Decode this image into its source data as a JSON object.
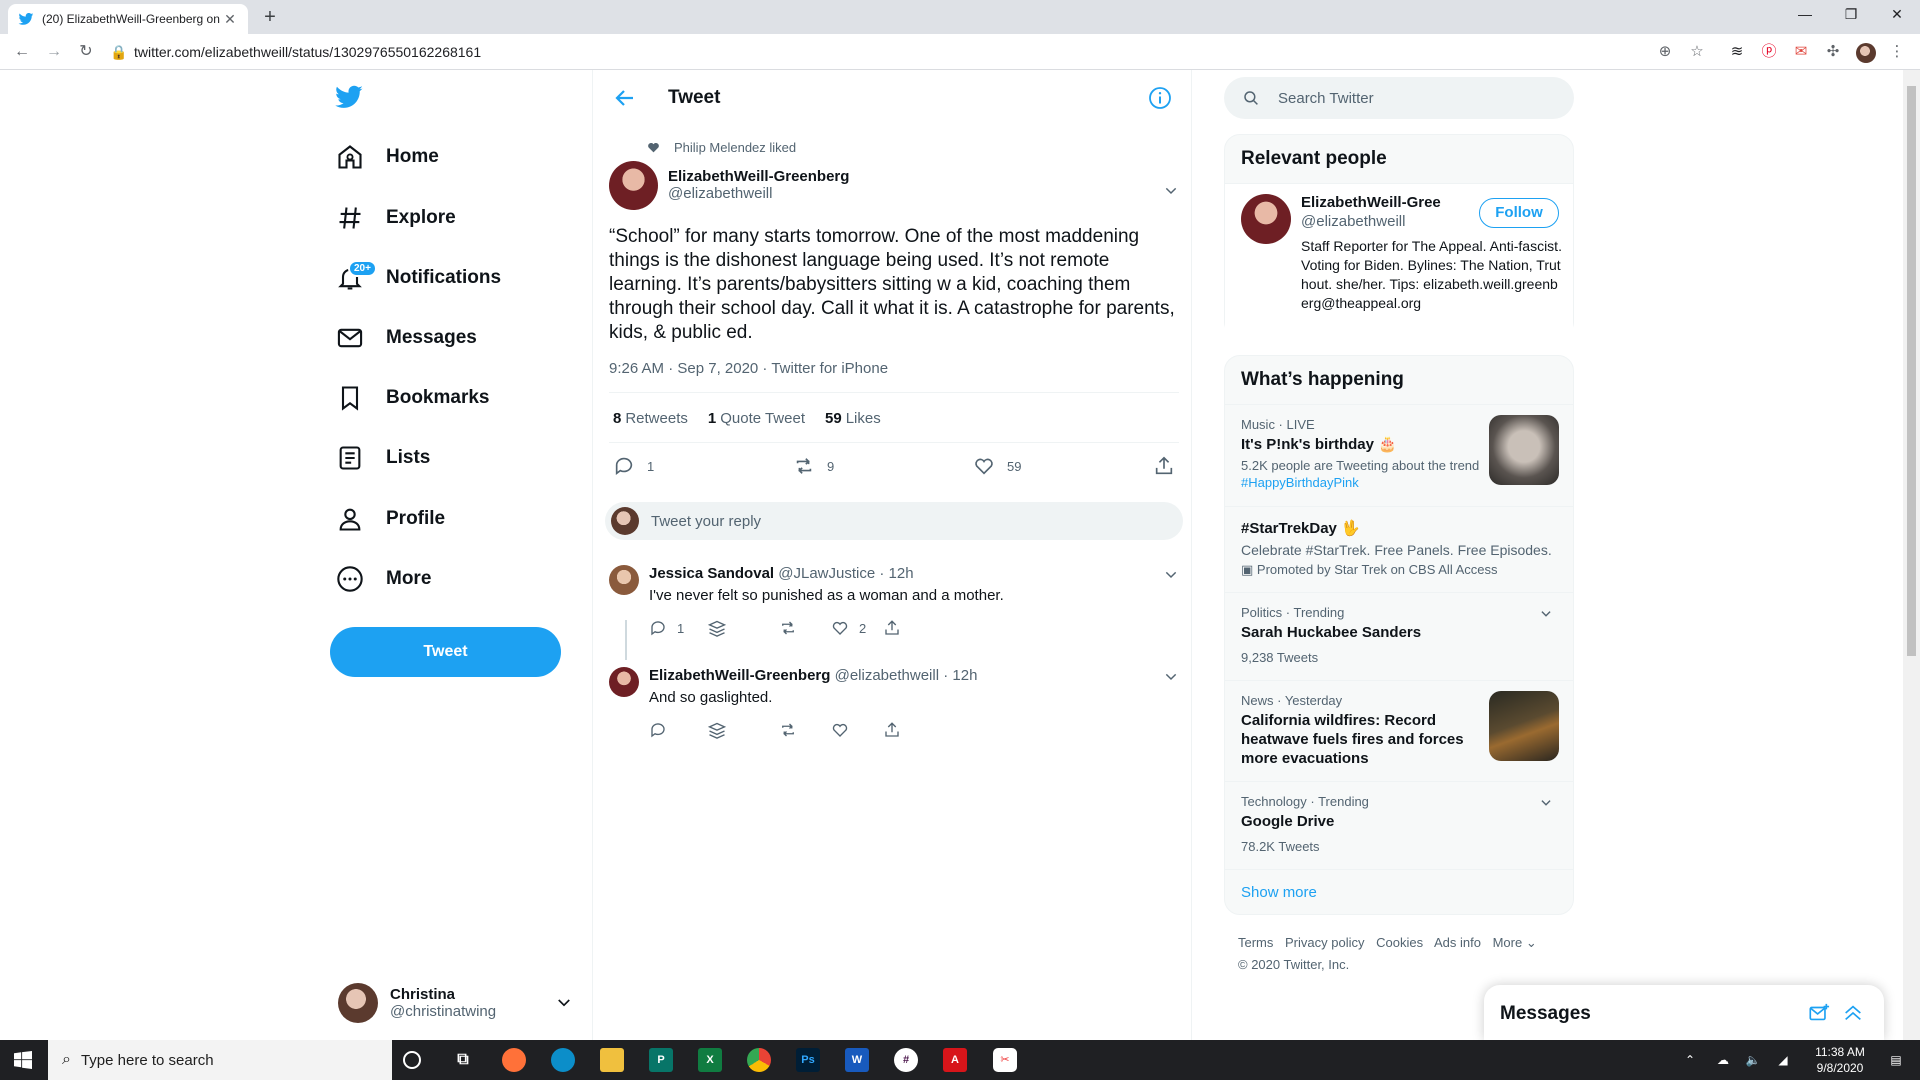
{
  "browser": {
    "tab_title": "(20) ElizabethWeill-Greenberg on",
    "url": "twitter.com/elizabethweill/status/1302976550162268161",
    "window_controls": [
      "minimize-icon",
      "maximize-icon",
      "close-icon"
    ]
  },
  "nav": {
    "items": [
      {
        "label": "Home",
        "icon": "home-icon"
      },
      {
        "label": "Explore",
        "icon": "hashtag-icon"
      },
      {
        "label": "Notifications",
        "icon": "bell-icon",
        "badge": "20+"
      },
      {
        "label": "Messages",
        "icon": "envelope-icon"
      },
      {
        "label": "Bookmarks",
        "icon": "bookmark-icon"
      },
      {
        "label": "Lists",
        "icon": "list-icon"
      },
      {
        "label": "Profile",
        "icon": "person-icon"
      },
      {
        "label": "More",
        "icon": "more-circle-icon"
      }
    ],
    "tweet_button": "Tweet",
    "account": {
      "name": "Christina",
      "handle": "@christinatwing"
    }
  },
  "main": {
    "header_title": "Tweet",
    "social_context": "Philip Melendez liked",
    "author": {
      "name": "ElizabethWeill-Greenberg",
      "handle": "@elizabethweill"
    },
    "text": "“School” for many starts tomorrow. One of the most maddening things is the dishonest language being used. It’s not remote learning. It’s parents/babysitters sitting w a kid, coaching them through their school day. Call it what it is. A catastrophe for parents, kids, & public ed.",
    "meta": "9:26 AM · Sep 7, 2020 · Twitter for iPhone",
    "stats": {
      "retweets_count": "8",
      "retweets_label": "Retweets",
      "quotes_count": "1",
      "quotes_label": "Quote Tweet",
      "likes_count": "59",
      "likes_label": "Likes"
    },
    "actions": {
      "replies": "1",
      "retweets": "9",
      "likes": "59"
    },
    "reply_placeholder": "Tweet your reply",
    "replies": [
      {
        "name": "Jessica Sandoval",
        "handle": "@JLawJustice",
        "time": "· 12h",
        "text": "I've never felt so punished as a woman and a mother.",
        "reply_count": "1",
        "like_count": "2"
      },
      {
        "name": "ElizabethWeill-Greenberg",
        "handle": "@elizabethweill",
        "time": "· 12h",
        "text": "And so gaslighted.",
        "reply_count": "",
        "like_count": ""
      }
    ]
  },
  "right": {
    "search_placeholder": "Search Twitter",
    "relevant": {
      "title": "Relevant people",
      "name": "ElizabethWeill-Green...",
      "handle": "@elizabethweill",
      "follow": "Follow",
      "bio": "Staff Reporter for The Appeal. Anti-fascist. Voting for Biden. Bylines: The Nation, Truthout. she/her. Tips: elizabeth.weill.greenberg@theappeal.org"
    },
    "happening": {
      "title": "What’s happening",
      "trends": [
        {
          "category": "Music · LIVE",
          "title": "It's P!nk's birthday 🎂",
          "sub": "5.2K people are Tweeting about the trend",
          "tag": "#HappyBirthdayPink"
        },
        {
          "category": "",
          "title": "#StarTrekDay 🖖",
          "sub": "Celebrate #StarTrek. Free Panels. Free Episodes.",
          "tag": "Promoted by Star Trek on CBS All Access"
        },
        {
          "category": "Politics · Trending",
          "title": "Sarah Huckabee Sanders",
          "sub": "9,238 Tweets",
          "tag": ""
        },
        {
          "category": "News · Yesterday",
          "title": "California wildfires: Record heatwave fuels fires and forces more evacuations",
          "sub": "",
          "tag": ""
        },
        {
          "category": "Technology · Trending",
          "title": "Google Drive",
          "sub": "78.2K Tweets",
          "tag": ""
        }
      ],
      "show_more": "Show more"
    },
    "footer": {
      "links": [
        "Terms",
        "Privacy policy",
        "Cookies",
        "Ads info",
        "More ⌄"
      ],
      "copyright": "© 2020 Twitter, Inc."
    },
    "messages_drawer": "Messages"
  },
  "taskbar": {
    "search_placeholder": "Type here to search",
    "time": "11:38 AM",
    "date": "9/8/2020"
  },
  "colors": {
    "accent": "#1da1f2",
    "text": "#0f1419",
    "secondary": "#536471"
  }
}
